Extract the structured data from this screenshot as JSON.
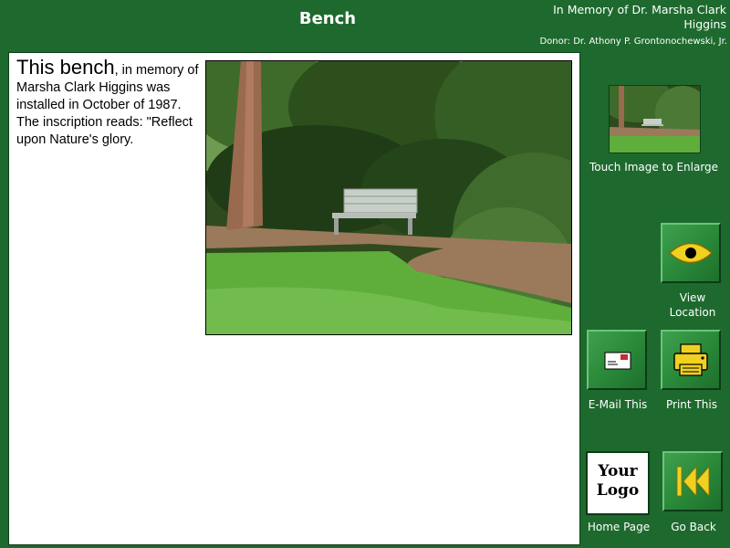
{
  "header": {
    "title": "Bench",
    "memorial": "In Memory of Dr. Marsha Clark Higgins",
    "donor": "Donor: Dr. Athony P. Grontonochewski, Jr."
  },
  "description": {
    "lead": "This bench",
    "body": ", in memory of Marsha Clark Higgins was installed in October of 1987. The inscription reads: \"Reflect upon Nature's glory."
  },
  "sidebar": {
    "thumbnail_label": "Touch Image to Enlarge",
    "view_location_label": "View Location",
    "email_label": "E-Mail This",
    "print_label": "Print This",
    "home_label": "Home Page",
    "back_label": "Go Back",
    "logo_line1": "Your",
    "logo_line2": "Logo"
  },
  "icons": {
    "view_location": "eye-icon",
    "email": "envelope-icon",
    "print": "printer-icon",
    "back": "rewind-icon"
  },
  "colors": {
    "background": "#1e6a2e",
    "button_green": "#2a8a3a",
    "icon_yellow": "#f0d020"
  }
}
